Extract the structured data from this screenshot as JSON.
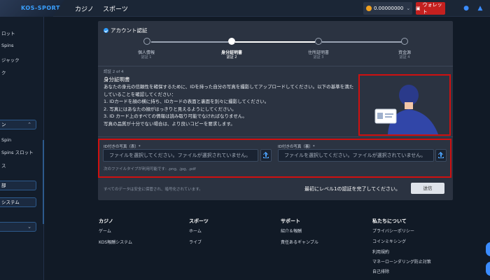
{
  "header": {
    "logo_text": "KOS-SPORT",
    "nav": [
      "カジノ",
      "スポーツ"
    ],
    "balance": "0.00000000",
    "wallet_label": "ウォレット"
  },
  "sidebar": {
    "items": [
      "ロット",
      "Spins",
      "ジャック",
      "ク",
      "ン",
      "Spin",
      "Spins スロット",
      "ス",
      "部",
      "システム"
    ]
  },
  "verification": {
    "title": "アカウント認証",
    "steps": [
      {
        "label": "個人情報",
        "sub": "認証 1"
      },
      {
        "label": "身分証明書",
        "sub": "認証 2"
      },
      {
        "label": "住所証明書",
        "sub": "認証 3"
      },
      {
        "label": "資金源",
        "sub": "認証 4"
      }
    ],
    "active_step": 2,
    "step_counter": "認証 2 of 4",
    "section_title": "身分証明書",
    "intro": "あなたの身元の信頼性を確保するために、IDを持った自分の写真を撮影してアップロードしてください。以下の基準を満たしていることを確認してください：",
    "rules": [
      "1. IDカードを顔の横に持ち、IDカードの表面と裏面を別々に撮影してください。",
      "2. 写真にはあなたの顔がはっきりと見えるようにしてください。",
      "3. ID カード上のすべての情報は読み取り可能でなければなりません。",
      "写真の品質が十分でない場合は、より良いコピーを要求します。"
    ],
    "front_label": "ID付きの写真（表）*",
    "back_label": "ID付きの写真（裏）*",
    "file_placeholder": "ファイルを選択してください。ファイルが選択されていません。",
    "file_types": "次のファイルタイプが利用可能です: .png, .jpg, .pdf",
    "secure_note": "すべてのデータは安全に保管され、暗号化されています。",
    "complete_note": "最初にレベル1の認証を完了してください。",
    "send_label": "送信"
  },
  "footer": {
    "columns": [
      {
        "title": "カジノ",
        "links": [
          "ゲーム",
          "KOS報酬システム"
        ]
      },
      {
        "title": "スポーツ",
        "links": [
          "ホーム",
          "ライブ"
        ]
      },
      {
        "title": "サポート",
        "links": [
          "紹介＆報酬",
          "責任あるギャンブル"
        ]
      },
      {
        "title": "私たちについて",
        "links": [
          "プライバシーポリシー",
          "コインミキシング",
          "利用規約",
          "マネーローンダリング防止対策",
          "自己排除"
        ]
      }
    ]
  },
  "colors": {
    "accent": "#2e9cff",
    "wallet": "#c4201f",
    "highlight_border": "#d01010"
  }
}
